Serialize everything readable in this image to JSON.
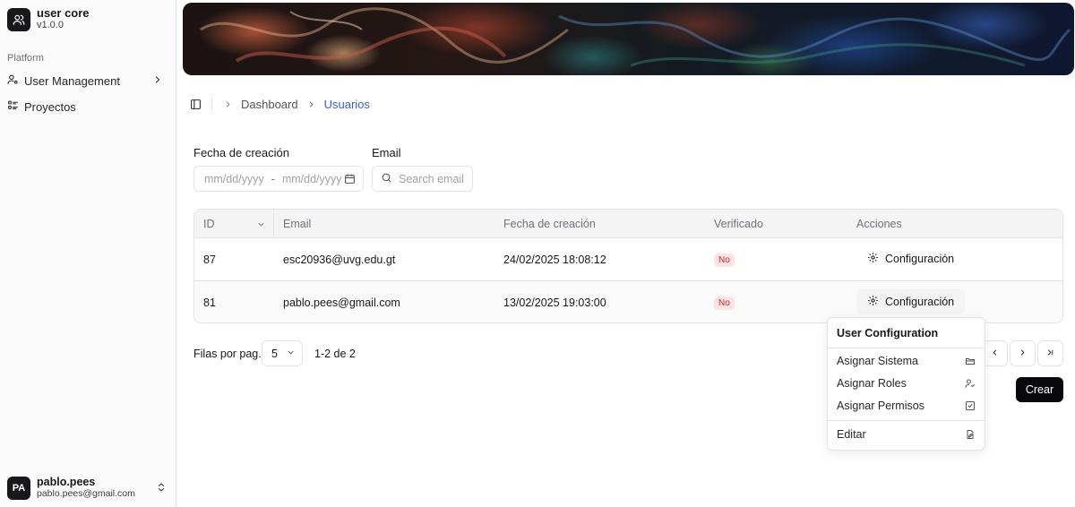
{
  "app": {
    "name": "user core",
    "version": "v1.0.0"
  },
  "sidebar": {
    "group_label": "Platform",
    "items": [
      {
        "label": "User Management",
        "icon": "user-settings-icon"
      },
      {
        "label": "Proyectos",
        "icon": "list-icon"
      }
    ],
    "user": {
      "initials": "PA",
      "name": "pablo.pees",
      "email": "pablo.pees@gmail.com"
    }
  },
  "breadcrumb": {
    "items": [
      "Dashboard",
      "Usuarios"
    ]
  },
  "filters": {
    "date_label": "Fecha de creación",
    "date_start_placeholder": "mm/dd/yyyy",
    "date_separator": "-",
    "date_end_placeholder": "mm/dd/yyyy",
    "email_label": "Email",
    "email_placeholder": "Search email"
  },
  "table": {
    "headers": [
      "ID",
      "Email",
      "Fecha de creación",
      "Verificado",
      "Acciones"
    ],
    "rows": [
      {
        "id": "87",
        "email": "esc20936@uvg.edu.gt",
        "date": "24/02/2025 18:08:12",
        "verified": "No",
        "action": "Configuración"
      },
      {
        "id": "81",
        "email": "pablo.pees@gmail.com",
        "date": "13/02/2025 19:03:00",
        "verified": "No",
        "action": "Configuración"
      }
    ]
  },
  "pagination": {
    "rows_label": "Filas por pag.",
    "rows_value": "5",
    "range": "1-2 de 2"
  },
  "create_label": "Crear",
  "menu": {
    "title": "User Configuration",
    "items": [
      "Asignar Sistema",
      "Asignar Roles",
      "Asignar Permisos",
      "Editar"
    ]
  },
  "colors": {
    "accent": "#3b5bdb",
    "badge_bg": "#fde2e2",
    "badge_text": "#dc2626",
    "primary": "#09090b"
  }
}
